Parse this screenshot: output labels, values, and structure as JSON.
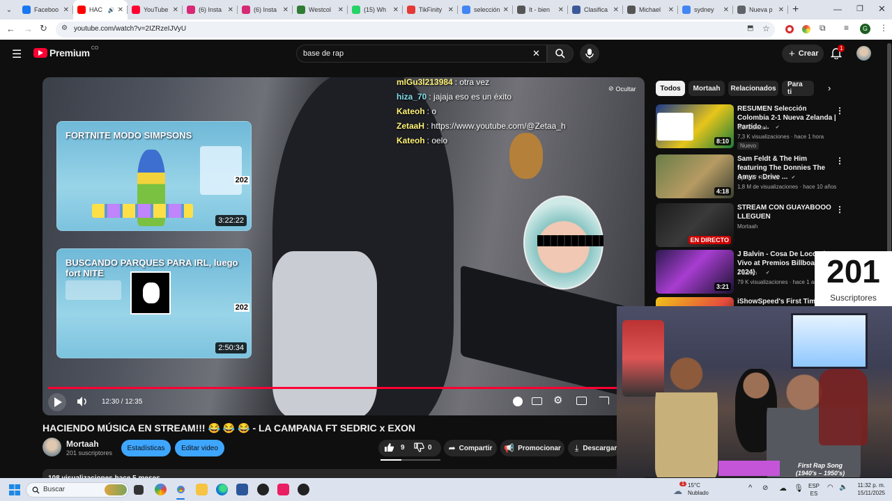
{
  "browser": {
    "tabs": [
      {
        "title": "Faceboo",
        "color": "#1877f2"
      },
      {
        "title": "HAC",
        "color": "#ff0000",
        "active": true
      },
      {
        "title": "YouTube",
        "color": "#ff0033"
      },
      {
        "title": "(6) Insta",
        "color": "#d62976"
      },
      {
        "title": "(6) Insta",
        "color": "#d62976"
      },
      {
        "title": "Westcol",
        "color": "#2e7d32"
      },
      {
        "title": "(15) Wh",
        "color": "#25d366"
      },
      {
        "title": "TikFinity",
        "color": "#e53935"
      },
      {
        "title": "selección",
        "color": "#4285f4"
      },
      {
        "title": "It - bien",
        "color": "#555555"
      },
      {
        "title": "Clasifica",
        "color": "#3b5998"
      },
      {
        "title": "Michael",
        "color": "#555555"
      },
      {
        "title": "sydney",
        "color": "#4285f4"
      },
      {
        "title": "Nueva p",
        "color": "#5f6368"
      }
    ],
    "url": "youtube.com/watch?v=2IZRzeIJVyU"
  },
  "youtube": {
    "brand": "Premium",
    "brand_sup": "CO",
    "search_value": "base de rap",
    "create_label": "Crear",
    "notif_count": "1"
  },
  "player": {
    "hide_label": "Ocultar",
    "time": "12:30 / 12:35",
    "progress_fraction": 0.993,
    "chat": [
      {
        "name": "mIGu3l213984",
        "text": ": otra vez",
        "color": "#fff176"
      },
      {
        "name": "hiza_70",
        "text": ": jajaja eso es un éxito",
        "color": "#80deea"
      },
      {
        "name": "Kateoh",
        "text": ": o",
        "color": "#fff176"
      },
      {
        "name": "ZetaaH",
        "text": ": https://www.youtube.com/@Zetaa_h",
        "color": "#fff176"
      },
      {
        "name": "Kateoh",
        "text": ": oelo",
        "color": "#fff176"
      }
    ],
    "end_cards": [
      {
        "title": "FORTNITE MODO SIMPSONS",
        "num": "202",
        "duration": "3:22:22"
      },
      {
        "title": "BUSCANDO PARQUES PARA IRL, luego fort NITE",
        "num": "202",
        "duration": "2:50:34"
      }
    ]
  },
  "video": {
    "title": "HACIENDO MÚSICA EN STREAM!!! 😂 😂 😂 - LA CAMPANA FT SEDRIC x EXON",
    "channel": "Mortaah",
    "subscribers": "201 suscriptores",
    "stats_btn": "Estadísticas",
    "edit_btn": "Editar video",
    "likes": "9",
    "dislikes": "0",
    "share": "Compartir",
    "promote": "Promocionar",
    "download": "Descargar",
    "desc_partial": "108 visualizaciones hace 5 meses"
  },
  "sidebar": {
    "chips": [
      "Todos",
      "Mortaah",
      "Relacionados",
      "Para ti"
    ],
    "items": [
      {
        "title": "RESUMEN Selección Colombia 2-1 Nueva Zelanda | Partido ...",
        "channel": "Gol Caracol",
        "meta": "7,3 K visualizaciones · hace 1 hora",
        "badge": "Nuevo",
        "duration": "8:10"
      },
      {
        "title": "Sam Feldt & The Him featuring The Donnies The Amys - Drive ...",
        "channel": "Spinnin' Records",
        "meta": "1,8 M de visualizaciones · hace 10 años",
        "duration": "4:18"
      },
      {
        "title": "STREAM CON GUAYABOOO LLEGUEN",
        "channel": "Mortaah",
        "meta": "",
        "duration": "EN DIRECTO"
      },
      {
        "title": "J Balvin - Cosa De Locos (En Vivo at Premios Billboard 2024)",
        "channel": "J Balvin",
        "meta": "79 K visualizaciones · hace 1 año",
        "duration": "3:21"
      },
      {
        "title": "iShowSpeed's First Time In",
        "channel": "",
        "meta": "",
        "duration": ""
      }
    ]
  },
  "overlay": {
    "subs_number": "201",
    "subs_label": "Suscriptores",
    "rap_caption_1": "First Rap Song",
    "rap_caption_2": "(1940's – 1950's)"
  },
  "taskbar": {
    "search_placeholder": "Buscar",
    "weather_temp": "15°C",
    "weather_desc": "Nublado",
    "weather_badge": "1",
    "lang_1": "ESP",
    "lang_2": "ES",
    "time": "11:32 p. m.",
    "date": "15/11/2025"
  }
}
